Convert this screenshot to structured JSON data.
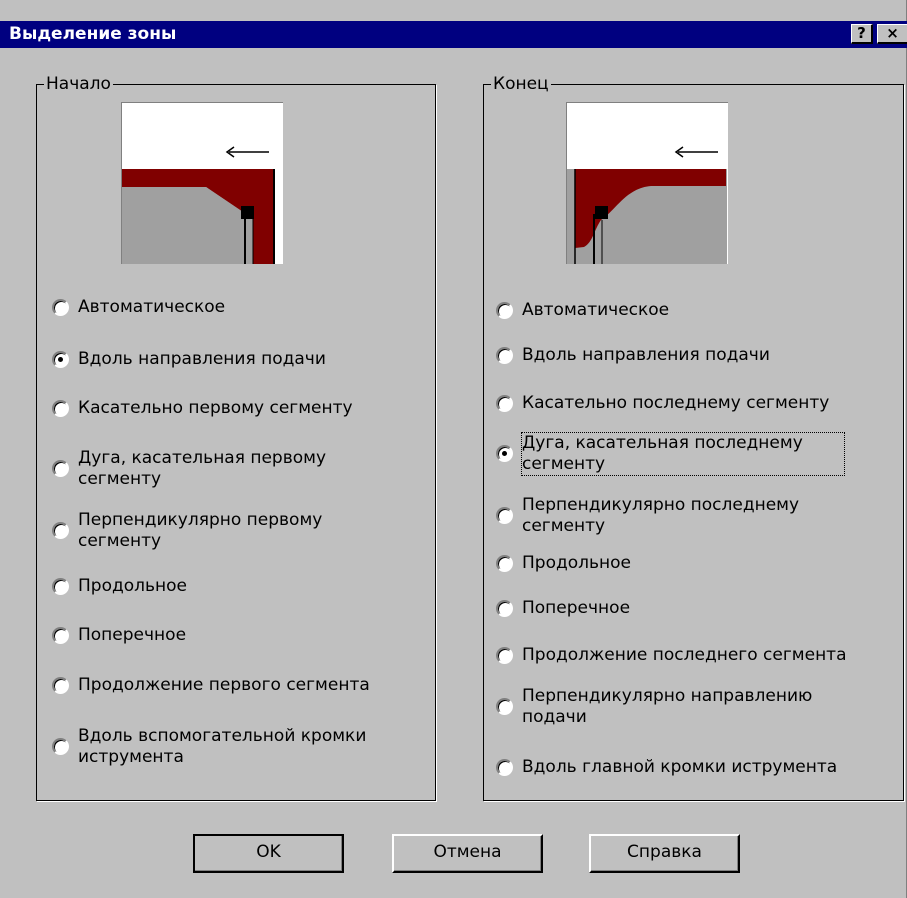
{
  "window": {
    "title": "Выделение зоны",
    "help_glyph": "?",
    "close_glyph": "×"
  },
  "start_group": {
    "legend": "Начало",
    "preview_arrow_icon": "left-arrow",
    "options": [
      {
        "label": "Автоматическое",
        "checked": false
      },
      {
        "label": "Вдоль направления подачи",
        "checked": true
      },
      {
        "label": "Касательно первому сегменту",
        "checked": false
      },
      {
        "label": "Дуга, касательная первому сегменту",
        "checked": false
      },
      {
        "label": "Перпендикулярно первому сегменту",
        "checked": false
      },
      {
        "label": "Продольное",
        "checked": false
      },
      {
        "label": "Поперечное",
        "checked": false
      },
      {
        "label": "Продолжение первого сегмента",
        "checked": false
      },
      {
        "label": "Вдоль вспомогательной кромки иструмента",
        "checked": false
      }
    ]
  },
  "end_group": {
    "legend": "Конец",
    "preview_arrow_icon": "left-arrow",
    "options": [
      {
        "label": "Автоматическое",
        "checked": false
      },
      {
        "label": "Вдоль направления подачи",
        "checked": false
      },
      {
        "label": "Касательно последнему сегменту",
        "checked": false
      },
      {
        "label": "Дуга, касательная последнему сегменту",
        "checked": true
      },
      {
        "label": "Перпендикулярно последнему сегменту",
        "checked": false
      },
      {
        "label": "Продольное",
        "checked": false
      },
      {
        "label": "Поперечное",
        "checked": false
      },
      {
        "label": "Продолжение последнего сегмента",
        "checked": false
      },
      {
        "label": "Перпендикулярно направлению подачи",
        "checked": false
      },
      {
        "label": "Вдоль главной кромки иструмента",
        "checked": false
      }
    ]
  },
  "buttons": {
    "ok": "OK",
    "cancel": "Отмена",
    "help": "Справка"
  },
  "colors": {
    "dialog_bg": "#c0c0c0",
    "title_bg": "#000080",
    "tool_red": "#800000",
    "part_gray": "#a0a0a0"
  }
}
